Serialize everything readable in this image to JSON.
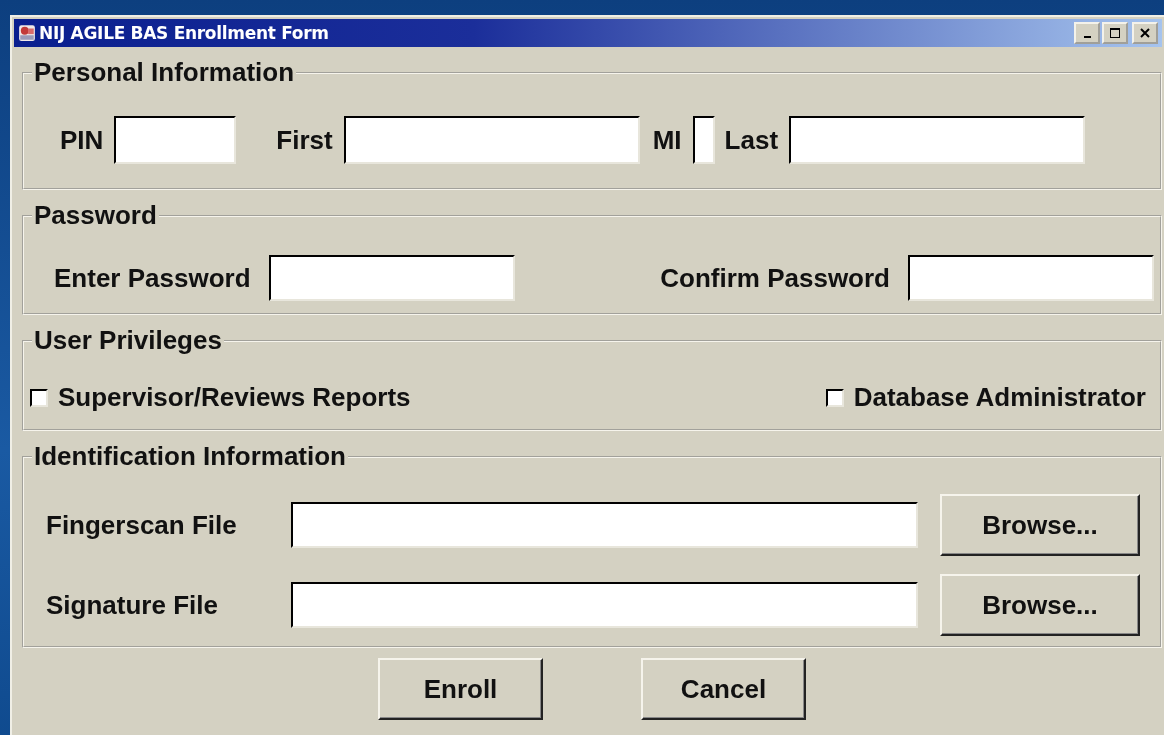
{
  "window": {
    "title": "NIJ AGILE BAS Enrollment Form"
  },
  "sections": [
    {
      "kind": "fields",
      "legend": "Personal Information",
      "fields": [
        {
          "label": "PIN"
        },
        {
          "label": "First"
        },
        {
          "label": "MI"
        },
        {
          "label": "Last"
        }
      ]
    },
    {
      "kind": "fields",
      "legend": "Password",
      "fields": [
        {
          "label": "Enter Password"
        },
        {
          "label": "Confirm Password"
        }
      ]
    },
    {
      "kind": "checkboxes",
      "legend": "User Privileges",
      "options": [
        {
          "label": "Supervisor/Reviews Reports",
          "checked": false
        },
        {
          "label": "Database Administrator",
          "checked": false
        }
      ]
    },
    {
      "kind": "files",
      "legend": "Identification Information",
      "files": [
        {
          "label": "Fingerscan File",
          "button": "Browse..."
        },
        {
          "label": "Signature File",
          "button": "Browse..."
        }
      ]
    }
  ],
  "buttons": [
    "Enroll",
    "Cancel"
  ]
}
